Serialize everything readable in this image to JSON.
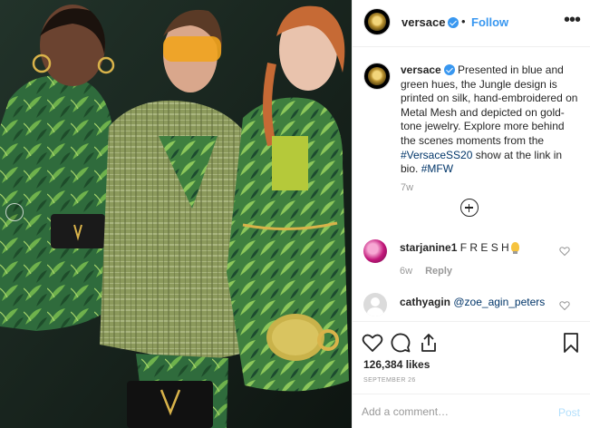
{
  "post": {
    "username": "versace",
    "follow_label": "Follow",
    "separator": "•",
    "more_glyph": "•••"
  },
  "caption": {
    "username": "versace",
    "text_before_tag": " Presented in blue and green hues, the Jungle design is printed on silk, hand-embroidered on Metal Mesh and depicted on gold-tone jewelry. Explore more behind the scenes moments from the ",
    "hashtag1": "#VersaceSS20",
    "text_after_tag": " show at the link in bio. ",
    "hashtag2": "#MFW",
    "time": "7w"
  },
  "comments": [
    {
      "username": "starjanine1",
      "text": " F R E S H",
      "emoji": "light-bulb",
      "time": "6w",
      "reply_label": "Reply"
    },
    {
      "username": "cathyagin",
      "mention": "@zoe_agin_peters"
    }
  ],
  "likes": "126,384 likes",
  "date": "September 26",
  "comment_box": {
    "placeholder": "Add a comment…",
    "post_label": "Post"
  },
  "colors": {
    "link": "#3897f0",
    "hashtag": "#003569",
    "muted": "#999999",
    "post_disabled": "#b2dffc"
  }
}
